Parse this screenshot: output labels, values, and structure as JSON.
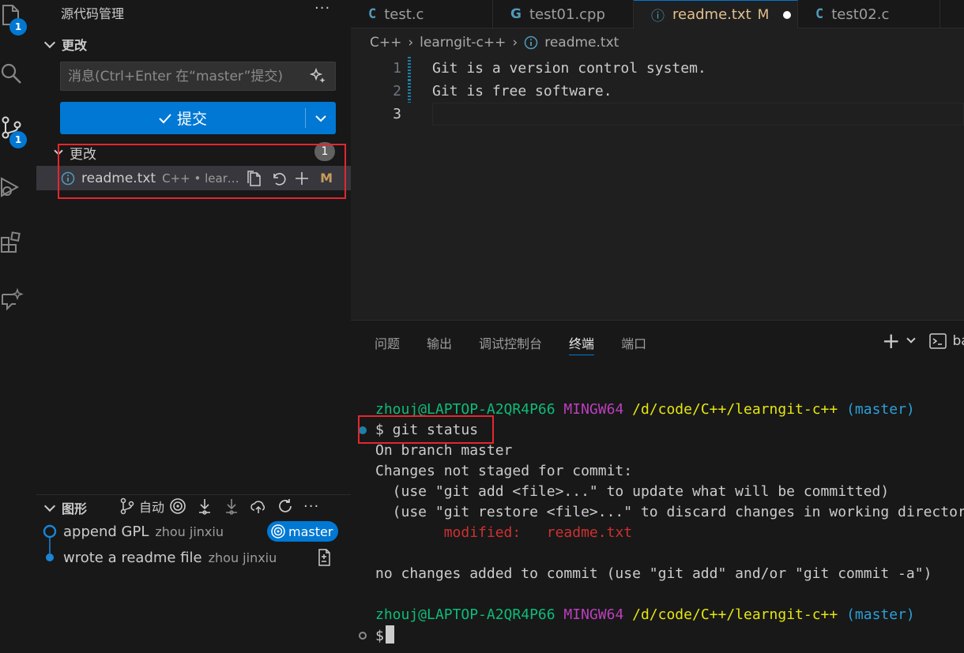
{
  "activity_bar": {
    "explorer_badge": "1",
    "scm_badge": "1"
  },
  "sidebar": {
    "title": "源代码管理",
    "more": "···",
    "changes_section": "更改",
    "commit_message_placeholder": "消息(Ctrl+Enter 在“master”提交)",
    "commit_button_label": "提交",
    "changes_group": {
      "label": "更改",
      "count": "1"
    },
    "changed_files": [
      {
        "name": "readme.txt",
        "description": "C++ • learngit-c++",
        "status": "M"
      }
    ],
    "graph": {
      "title": "图形",
      "auto_label": "自动",
      "more": "···",
      "commits": [
        {
          "message": "append GPL",
          "author": "zhou jinxiu",
          "branch": "master"
        },
        {
          "message": "wrote a readme file",
          "author": "zhou jinxiu"
        }
      ]
    }
  },
  "editor": {
    "tabs": [
      {
        "icon": "C",
        "label": "test.c"
      },
      {
        "icon": "G",
        "label": "test01.cpp"
      },
      {
        "icon": "ⓘ",
        "label": "readme.txt",
        "status": "M",
        "dirty": true
      },
      {
        "icon": "C",
        "label": "test02.c"
      }
    ],
    "breadcrumb": [
      "C++",
      "learngit-c++",
      "readme.txt"
    ],
    "lines": [
      {
        "num": "1",
        "text": "Git is a version control system."
      },
      {
        "num": "2",
        "text": "Git is free software."
      },
      {
        "num": "3",
        "text": ""
      }
    ]
  },
  "panel": {
    "tabs": [
      "问题",
      "输出",
      "调试控制台",
      "终端",
      "端口"
    ],
    "active_tab": "终端",
    "shell_label": "ba",
    "terminal": {
      "prompt1": {
        "user": "zhouj@LAPTOP-A2QR4P66",
        "env": "MINGW64",
        "path": "/d/code/C++/learngit-c++",
        "branch": "(master)"
      },
      "command": "$ git status",
      "output": [
        "On branch master",
        "Changes not staged for commit:",
        "  (use \"git add <file>...\" to update what will be committed)",
        "  (use \"git restore <file>...\" to discard changes in working directory)"
      ],
      "modified_label": "        modified:",
      "modified_file": "readme.txt",
      "summary": "no changes added to commit (use \"git add\" and/or \"git commit -a\")",
      "prompt2": {
        "user": "zhouj@LAPTOP-A2QR4P66",
        "env": "MINGW64",
        "path": "/d/code/C++/learngit-c++",
        "branch": "(master)"
      },
      "final_prompt": "$"
    }
  },
  "colors": {
    "accent": "#0078d4",
    "highlight_box": "#e5262f",
    "modified": "#e2c08d",
    "terminal_user": "#0dbc79",
    "terminal_env": "#bc3fbc",
    "terminal_path": "#e5e510",
    "terminal_branch": "#2aa0d9",
    "terminal_modified": "#cd3131"
  }
}
